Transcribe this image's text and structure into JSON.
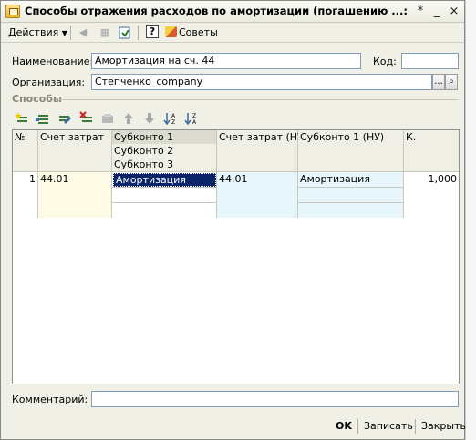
{
  "window": {
    "title": "Способы отражения расходов по амортизации (погашению ...: Новый *",
    "btn_pin": "*",
    "btn_min": "_",
    "btn_max": "□",
    "btn_close": "×"
  },
  "toolbar": {
    "actions_label": "Действия",
    "help_label": "?",
    "tips_label": "Советы"
  },
  "form": {
    "name_label": "Наименование:",
    "name_value": "Амортизация на сч. 44",
    "code_label": "Код:",
    "code_value": "",
    "org_label": "Организация:",
    "org_value": "Степченко_company",
    "org_select_btn": "...",
    "org_search_btn": "⌕",
    "section_title": "Способы",
    "comment_label": "Комментарий:",
    "comment_value": ""
  },
  "table": {
    "headers": {
      "num": "№",
      "account": "Счет затрат",
      "subconto1": "Субконто 1",
      "subconto2": "Субконто 2",
      "subconto3": "Субконто 3",
      "account_nu": "Счет затрат (НУ)",
      "subconto1_nu": "Субконто 1 (НУ)",
      "coef": "К."
    },
    "rows": [
      {
        "num": "1",
        "account": "44.01",
        "subconto1": "Амортизация",
        "subconto2": "",
        "subconto3": "",
        "account_nu": "44.01",
        "subconto1_nu": "Амортизация",
        "coef": "1,000"
      }
    ]
  },
  "footer": {
    "ok_label": "OK",
    "save_label": "Записать",
    "close_label": "Закрыть"
  },
  "colors": {
    "selected_cell": "#0a246a",
    "account_col_bg": "#fdfbe6",
    "nu_col_bg": "#e6f6fb"
  }
}
